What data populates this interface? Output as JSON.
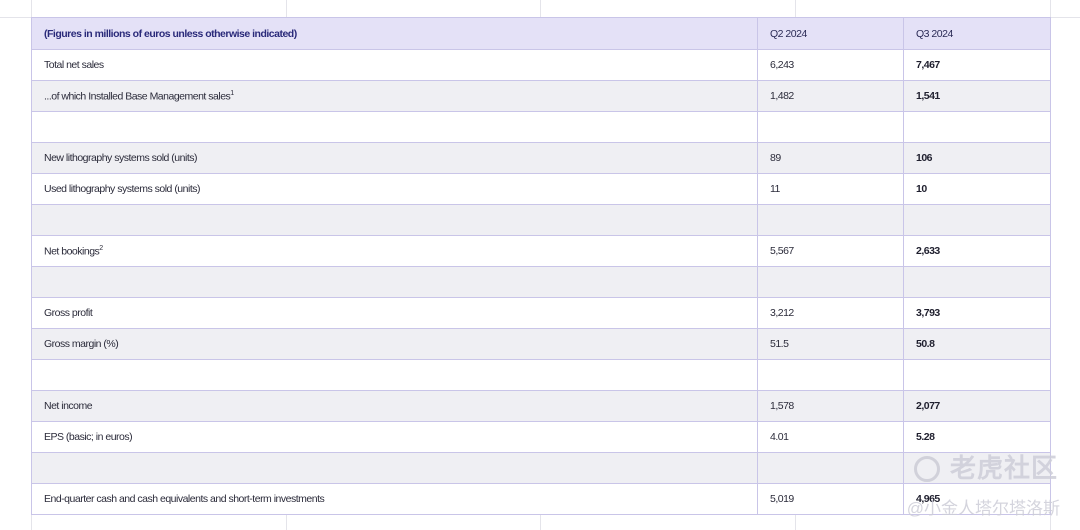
{
  "table": {
    "header": {
      "label": "(Figures in millions of euros unless otherwise indicated)",
      "col_q2": "Q2 2024",
      "col_q3": "Q3 2024"
    },
    "rows": [
      {
        "label": "Total net sales",
        "sup": "",
        "q2": "6,243",
        "q3": "7,467"
      },
      {
        "label": "...of which Installed Base Management sales",
        "sup": "1",
        "q2": "1,482",
        "q3": "1,541"
      },
      {
        "label": "",
        "sup": "",
        "q2": "",
        "q3": ""
      },
      {
        "label": "New lithography systems sold (units)",
        "sup": "",
        "q2": "89",
        "q3": "106"
      },
      {
        "label": "Used lithography systems sold (units)",
        "sup": "",
        "q2": "11",
        "q3": "10"
      },
      {
        "label": "",
        "sup": "",
        "q2": "",
        "q3": ""
      },
      {
        "label": "Net bookings",
        "sup": "2",
        "q2": "5,567",
        "q3": "2,633"
      },
      {
        "label": "",
        "sup": "",
        "q2": "",
        "q3": ""
      },
      {
        "label": "Gross profit",
        "sup": "",
        "q2": "3,212",
        "q3": "3,793"
      },
      {
        "label": "Gross margin (%)",
        "sup": "",
        "q2": "51.5",
        "q3": "50.8"
      },
      {
        "label": "",
        "sup": "",
        "q2": "",
        "q3": ""
      },
      {
        "label": "Net income",
        "sup": "",
        "q2": "1,578",
        "q3": "2,077"
      },
      {
        "label": "EPS (basic; in euros)",
        "sup": "",
        "q2": "4.01",
        "q3": "5.28"
      },
      {
        "label": "",
        "sup": "",
        "q2": "",
        "q3": ""
      },
      {
        "label": "End-quarter cash and cash equivalents and short-term investments",
        "sup": "",
        "q2": "5,019",
        "q3": "4,965"
      }
    ]
  },
  "watermark": {
    "logo_text": "老虎社区",
    "user_text": "@小金人塔尔塔洛斯"
  }
}
